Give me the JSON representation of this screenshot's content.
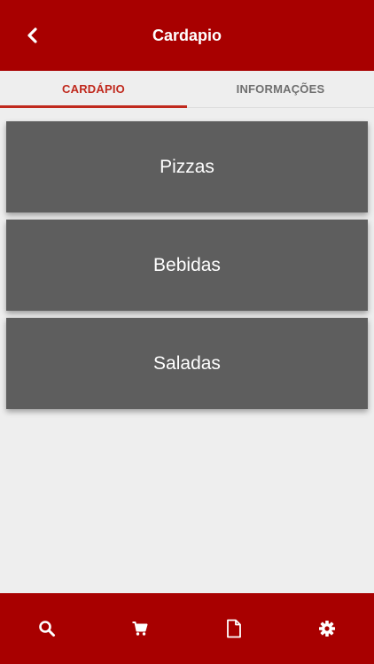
{
  "header": {
    "title": "Cardapio",
    "back_icon": "chevron-left-icon",
    "background_color": "#a80000"
  },
  "tabs": [
    {
      "label": "CARDÁPIO",
      "active": true
    },
    {
      "label": "INFORMAÇÕES",
      "active": false
    }
  ],
  "accent_color": "#c0291d",
  "menu": {
    "items": [
      {
        "label": "Pizzas"
      },
      {
        "label": "Bebidas"
      },
      {
        "label": "Saladas"
      }
    ],
    "card_color": "#5e5e5e"
  },
  "bottom_nav": {
    "items": [
      {
        "icon": "search-icon"
      },
      {
        "icon": "cart-icon"
      },
      {
        "icon": "document-icon"
      },
      {
        "icon": "settings-gear-icon"
      }
    ]
  }
}
